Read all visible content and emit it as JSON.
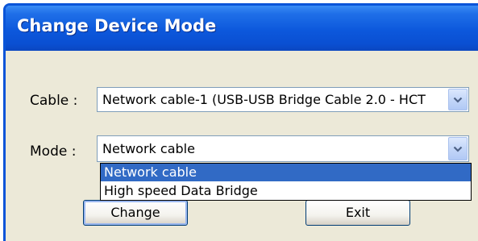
{
  "window": {
    "title": "Change Device Mode"
  },
  "cable": {
    "label": "Cable :",
    "value": "Network cable-1 (USB-USB Bridge Cable 2.0 - HCT",
    "dropdown_icon": "chevron-down-icon"
  },
  "mode": {
    "label": "Mode :",
    "value": "Network cable",
    "dropdown_icon": "chevron-down-icon",
    "options": [
      "Network cable",
      "High speed Data Bridge"
    ],
    "selected_index": 0
  },
  "buttons": {
    "change": "Change",
    "exit": "Exit"
  },
  "colors": {
    "titlebar": "#0a54d8",
    "selection": "#316ac5",
    "window_bg": "#ece9d8"
  }
}
